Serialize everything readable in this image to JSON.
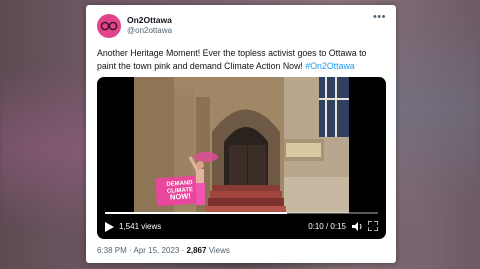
{
  "tweet": {
    "display_name": "On2Ottawa",
    "handle": "@on2ottawa",
    "text_main": "Another Heritage Moment! Ever the topless activist goes to Ottawa to paint the town pink and demand Climate Action Now! ",
    "hashtag": "#On2Ottawa",
    "more_icon": "more-horizontal-icon"
  },
  "video": {
    "views": "1,541 views",
    "time": "0:10 / 0:15",
    "progress": 0.667,
    "sign_line1": "DEMAND",
    "sign_line2": "CLIMATE",
    "sign_line3": "NOW!"
  },
  "meta": {
    "time": "6:38 PM",
    "separator": "·",
    "date": "Apr 15, 2023",
    "views_count": "2,867",
    "views_label": "Views"
  },
  "colors": {
    "accent": "#1d9bf0",
    "avatar": "#e0458b",
    "paint_pink": "#e64a9e"
  }
}
